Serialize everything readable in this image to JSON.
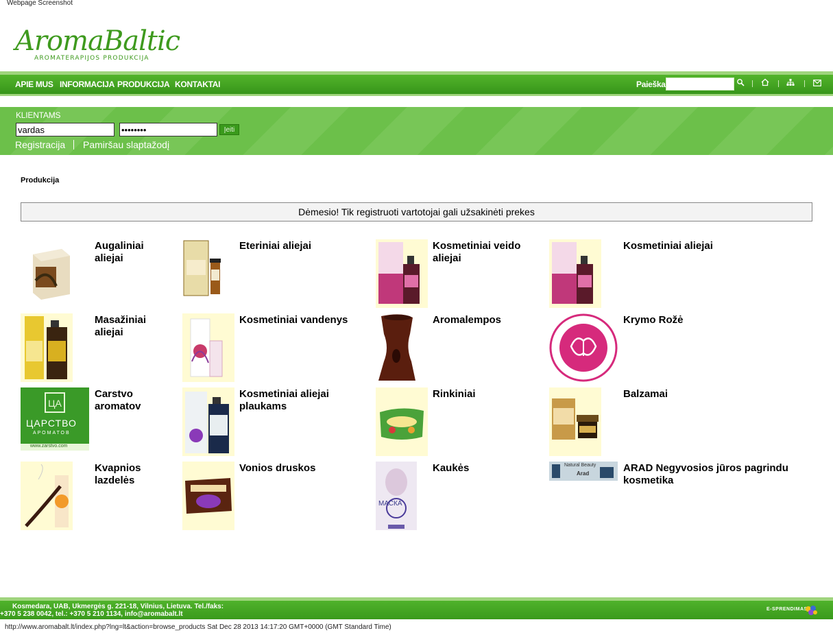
{
  "caption": "Webpage Screenshot",
  "logo": {
    "main": "AromaBaltic",
    "sub": "AROMATERAPIJOS  PRODUKCIJA"
  },
  "nav": {
    "items": [
      "APIE MUS",
      "INFORMACIJA",
      "PRODUKCIJA",
      "KONTAKTAI"
    ],
    "search_label": "Paieška",
    "search_value": ""
  },
  "login": {
    "title": "KLIENTAMS",
    "username_value": "vardas",
    "password_value": "••••••••",
    "button": "Įeiti",
    "register": "Registracija",
    "forgot": "Pamiršau slaptažodį"
  },
  "breadcrumb": "Produkcija",
  "notice": "Dėmesio! Tik registruoti vartotojai gali užsakinėti prekes",
  "products": [
    "Augaliniai aliejai",
    "Eteriniai aliejai",
    "Kosmetiniai veido aliejai",
    "Kosmetiniai aliejai",
    "Masažiniai aliejai",
    "Kosmetiniai vandenys",
    "Aromalempos",
    "Krymo Rožė",
    "Carstvo aromatov",
    "Kosmetiniai aliejai plaukams",
    "Rinkiniai",
    "Balzamai",
    "Kvapnios lazdelės",
    "Vonios druskos",
    "Kaukės",
    "ARAD Negyvosios jūros pagrindu kosmetika"
  ],
  "thumb_text": {
    "carstvo": "ЦАРСТВО",
    "carstvo_sub": "АРОМАТОВ",
    "carstvo_url": "www.zarstvo.com",
    "maska": "МАСКА",
    "arad_brand": "Natural Beauty",
    "arad": "Arad"
  },
  "footer": {
    "text": "Kosmedara, UAB, Ukmergės g. 221-18, Vilnius, Lietuva. Tel./faks: +370 5 238 0042,  tel.: +370 5 210 1134, info@aromabalt.lt",
    "brand": "E-SPRENDIMAS"
  },
  "status": "http://www.aromabalt.lt/index.php?lng=lt&action=browse_products Sat Dec 28 2013 14:17:20 GMT+0000 (GMT Standard Time)",
  "colors": {
    "green": "#3a9a1c",
    "light_green": "#9fd47c",
    "thumb_bg": "#fffbd3"
  }
}
